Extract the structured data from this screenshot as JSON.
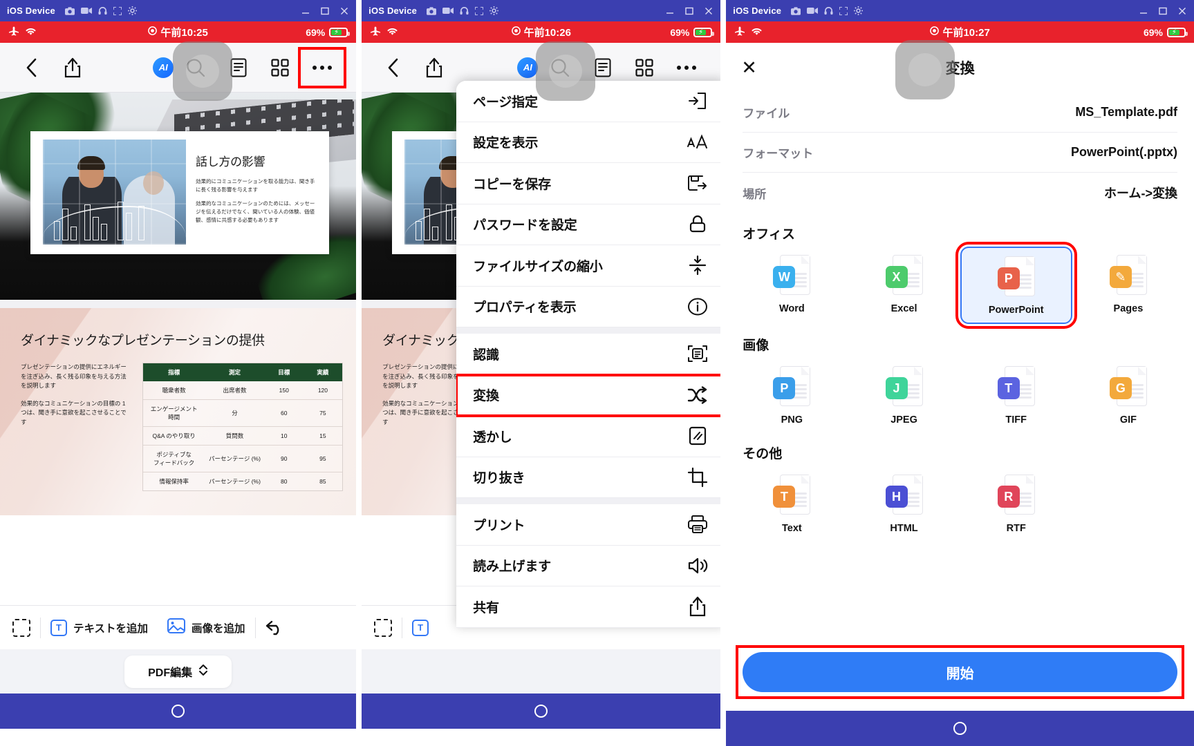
{
  "window": {
    "title": "iOS Device",
    "icons": [
      "camera-icon",
      "video-icon",
      "headphone-icon",
      "fullscreen-icon",
      "gear-icon"
    ],
    "controls": [
      "minimize",
      "maximize",
      "close"
    ]
  },
  "status_bars": [
    {
      "time": "午前10:25",
      "battery": "69%",
      "airplane": true,
      "wifi": true
    },
    {
      "time": "午前10:26",
      "battery": "69%",
      "airplane": true,
      "wifi": true
    },
    {
      "time": "午前10:27",
      "battery": "69%",
      "airplane": true,
      "wifi": true
    }
  ],
  "app_toolbar": {
    "back": "back-icon",
    "share": "share-icon",
    "ai": "AI",
    "search": "search-icon",
    "outline": "outline-icon",
    "thumbnails": "grid-icon",
    "more": "more-icon"
  },
  "slide1": {
    "title": "話し方の影響",
    "paragraphs": [
      "効果的にコミュニケーションを取る能力は、聞き手に長く残る影響を与えます",
      "効果的なコミュニケーションのためには、メッセージを伝えるだけでなく、聞いている人の体験、価値観、感情に共感する必要もあります"
    ]
  },
  "slide2": {
    "title": "ダイナミックなプレゼンテーションの提供",
    "paragraphs": [
      "プレゼンテーションの提供にエネルギーを注ぎ込み、長く残る印象を与える方法を説明します",
      "効果的なコミュニケーションの目標の 1 つは、聞き手に意欲を起こさせることです"
    ],
    "table": {
      "headers": [
        "指標",
        "測定",
        "目標",
        "実績"
      ],
      "rows": [
        [
          "聴衆者数",
          "出席者数",
          "150",
          "120"
        ],
        [
          "エンゲージメント\n時間",
          "分",
          "60",
          "75"
        ],
        [
          "Q&A のやり取り",
          "質問数",
          "10",
          "15"
        ],
        [
          "ポジティブな\nフィードバック",
          "パーセンテージ (%)",
          "90",
          "95"
        ],
        [
          "情報保持率",
          "パーセンテージ (%)",
          "80",
          "85"
        ]
      ]
    }
  },
  "edit_toolbar": {
    "select": "select-icon",
    "add_text": "テキストを追加",
    "add_image": "画像を追加",
    "undo": "undo-icon"
  },
  "mode_bar": {
    "label": "PDF編集"
  },
  "menu": {
    "groups": [
      [
        {
          "label": "ページ指定",
          "icon": "page-enter-icon"
        },
        {
          "label": "設定を表示",
          "icon": "text-size-icon"
        },
        {
          "label": "コピーを保存",
          "icon": "save-copy-icon"
        },
        {
          "label": "パスワードを設定",
          "icon": "lock-icon"
        },
        {
          "label": "ファイルサイズの縮小",
          "icon": "compress-icon"
        },
        {
          "label": "プロパティを表示",
          "icon": "info-icon"
        }
      ],
      [
        {
          "label": "認識",
          "icon": "ocr-scan-icon"
        },
        {
          "label": "変換",
          "icon": "convert-shuffle-icon",
          "highlighted": true
        },
        {
          "label": "透かし",
          "icon": "watermark-icon"
        },
        {
          "label": "切り抜き",
          "icon": "crop-icon"
        }
      ],
      [
        {
          "label": "プリント",
          "icon": "printer-icon"
        },
        {
          "label": "読み上げます",
          "icon": "speaker-icon"
        },
        {
          "label": "共有",
          "icon": "share-icon"
        }
      ]
    ]
  },
  "convert": {
    "close": "close-icon",
    "title": "変換",
    "info": [
      {
        "key": "ファイル",
        "value": "MS_Template.pdf"
      },
      {
        "key": "フォーマット",
        "value": "PowerPoint(.pptx)"
      },
      {
        "key": "場所",
        "value": "ホーム->変換"
      }
    ],
    "sections": [
      {
        "title": "オフィス",
        "items": [
          {
            "label": "Word",
            "letter": "W",
            "color": "#3ab0ee",
            "selected": false
          },
          {
            "label": "Excel",
            "letter": "X",
            "color": "#4dcb6c",
            "selected": false
          },
          {
            "label": "PowerPoint",
            "letter": "P",
            "color": "#e8624a",
            "selected": true
          },
          {
            "label": "Pages",
            "letter": "✎",
            "color": "#f3a93c",
            "selected": false
          }
        ]
      },
      {
        "title": "画像",
        "items": [
          {
            "label": "PNG",
            "letter": "P",
            "color": "#3a9eea",
            "selected": false
          },
          {
            "label": "JPEG",
            "letter": "J",
            "color": "#3fd49a",
            "selected": false
          },
          {
            "label": "TIFF",
            "letter": "T",
            "color": "#5b63e0",
            "selected": false
          },
          {
            "label": "GIF",
            "letter": "G",
            "color": "#f3a93c",
            "selected": false
          }
        ]
      },
      {
        "title": "その他",
        "items": [
          {
            "label": "Text",
            "letter": "T",
            "color": "#f0903a",
            "selected": false
          },
          {
            "label": "HTML",
            "letter": "H",
            "color": "#4b4fd4",
            "selected": false
          },
          {
            "label": "RTF",
            "letter": "R",
            "color": "#e0455a",
            "selected": false
          }
        ]
      }
    ],
    "start_button": "開始"
  }
}
